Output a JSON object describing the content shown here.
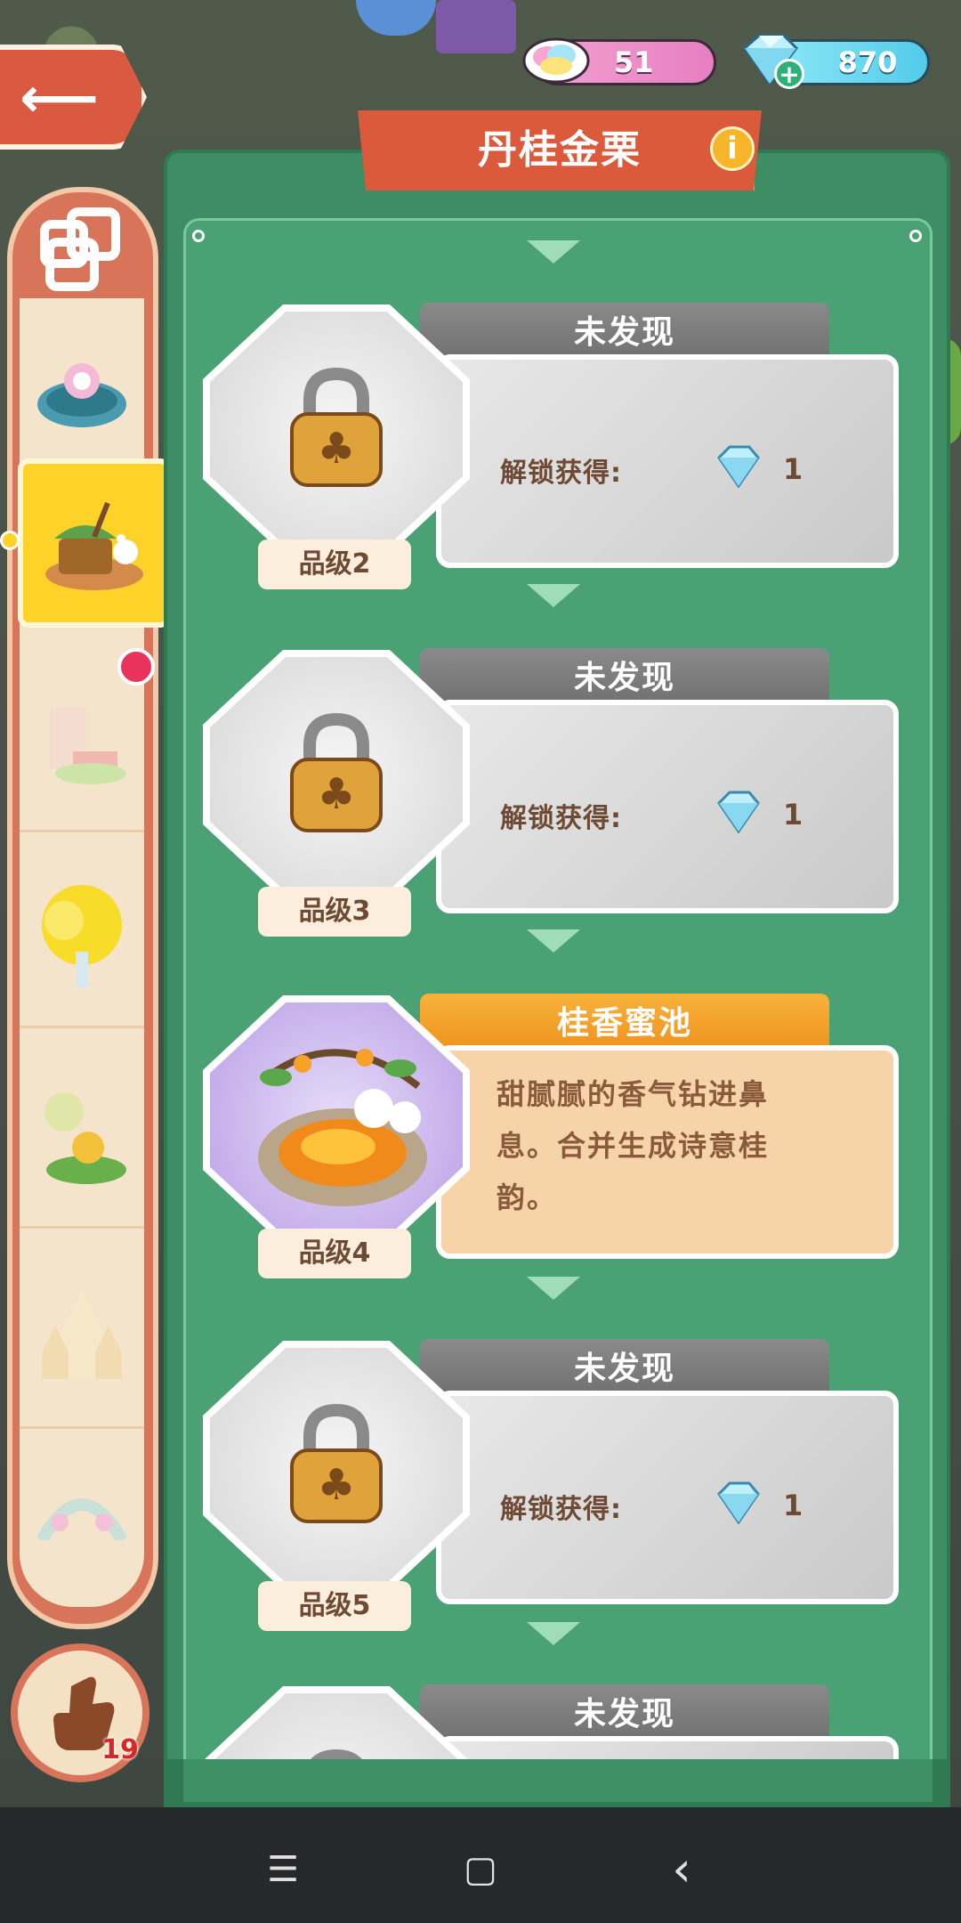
{
  "header": {
    "rainbow_count": "51",
    "gem_count": "870",
    "plus_symbol": "+",
    "back_icon": "back-arrow-icon"
  },
  "panel": {
    "title": "丹桂金栗",
    "info_symbol": "i"
  },
  "entries": [
    {
      "tab": "未发现",
      "reward_label": "解锁获得:",
      "reward_count": "1",
      "grade": "品级2"
    },
    {
      "tab": "未发现",
      "reward_label": "解锁获得:",
      "reward_count": "1",
      "grade": "品级3"
    },
    {
      "tab": "桂香蜜池",
      "desc_line1": "甜腻腻的香气钻进鼻",
      "desc_line2": "息。合并生成诗意桂",
      "desc_line3": "韵。",
      "grade": "品级4"
    },
    {
      "tab": "未发现",
      "reward_label": "解锁获得:",
      "reward_count": "1",
      "grade": "品级5"
    },
    {
      "tab": "未发现"
    }
  ],
  "sidebar": {
    "hand_count": "19"
  },
  "colors": {
    "panel_green": "#3f8d64",
    "title_red": "#db5a3c",
    "selected_yellow": "#ffd22a",
    "gray_tab": "#7a7a7a",
    "orange_tab": "#f2a02a"
  },
  "navbar": {
    "menu_symbol": "☰",
    "home_symbol": "▢",
    "back_symbol": "‹"
  }
}
